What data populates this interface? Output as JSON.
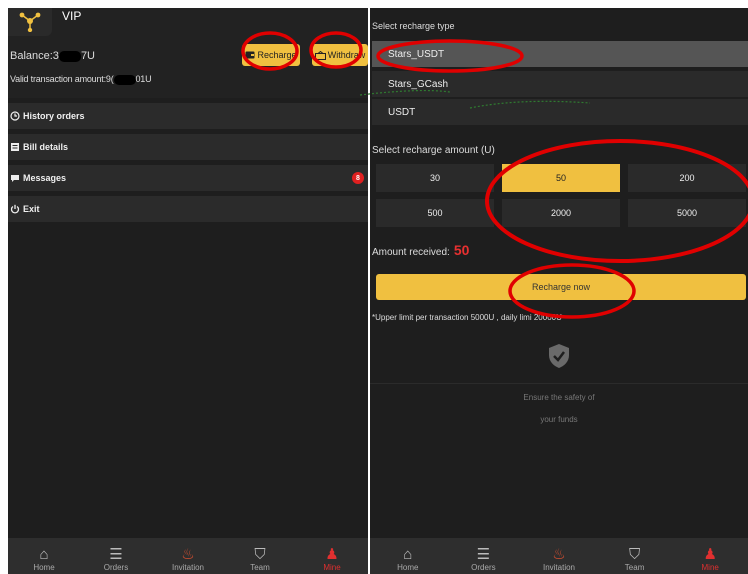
{
  "left": {
    "header": {
      "title": "VIP",
      "balance_prefix": "Balance:3",
      "balance_suffix": "7U",
      "valid_prefix": "Valid transaction amount:9(",
      "valid_suffix": "01U",
      "recharge_label": "Recharge",
      "withdraw_label": "Withdraw"
    },
    "menu": [
      {
        "label": "History orders",
        "icon": "clock-icon"
      },
      {
        "label": "Bill details",
        "icon": "bill-icon"
      },
      {
        "label": "Messages",
        "icon": "chat-icon",
        "badge": "8"
      },
      {
        "label": "Exit",
        "icon": "power-icon"
      }
    ]
  },
  "right": {
    "type_title": "Select recharge type",
    "types": [
      "Stars_USDT",
      "Stars_GCash",
      "USDT"
    ],
    "amount_title": "Select recharge amount (U)",
    "amounts": [
      "30",
      "50",
      "200",
      "500",
      "2000",
      "5000"
    ],
    "selected_amount": "50",
    "received_label": "Amount received:",
    "received_value": "50",
    "recharge_now": "Recharge now",
    "limit_text": "*Upper limit per transaction 5000U , daily limi 20000U",
    "safety_line1": "Ensure the safety of",
    "safety_line2": "your funds"
  },
  "nav": [
    {
      "label": "Home",
      "icon": "home-icon"
    },
    {
      "label": "Orders",
      "icon": "orders-icon"
    },
    {
      "label": "Invitation",
      "icon": "fire-icon"
    },
    {
      "label": "Team",
      "icon": "team-icon"
    },
    {
      "label": "Mine",
      "icon": "user-icon",
      "active": true
    }
  ],
  "colors": {
    "accent": "#f0c040",
    "background": "#1e1e1e",
    "annotation": "#e00000",
    "active": "#e03030"
  }
}
